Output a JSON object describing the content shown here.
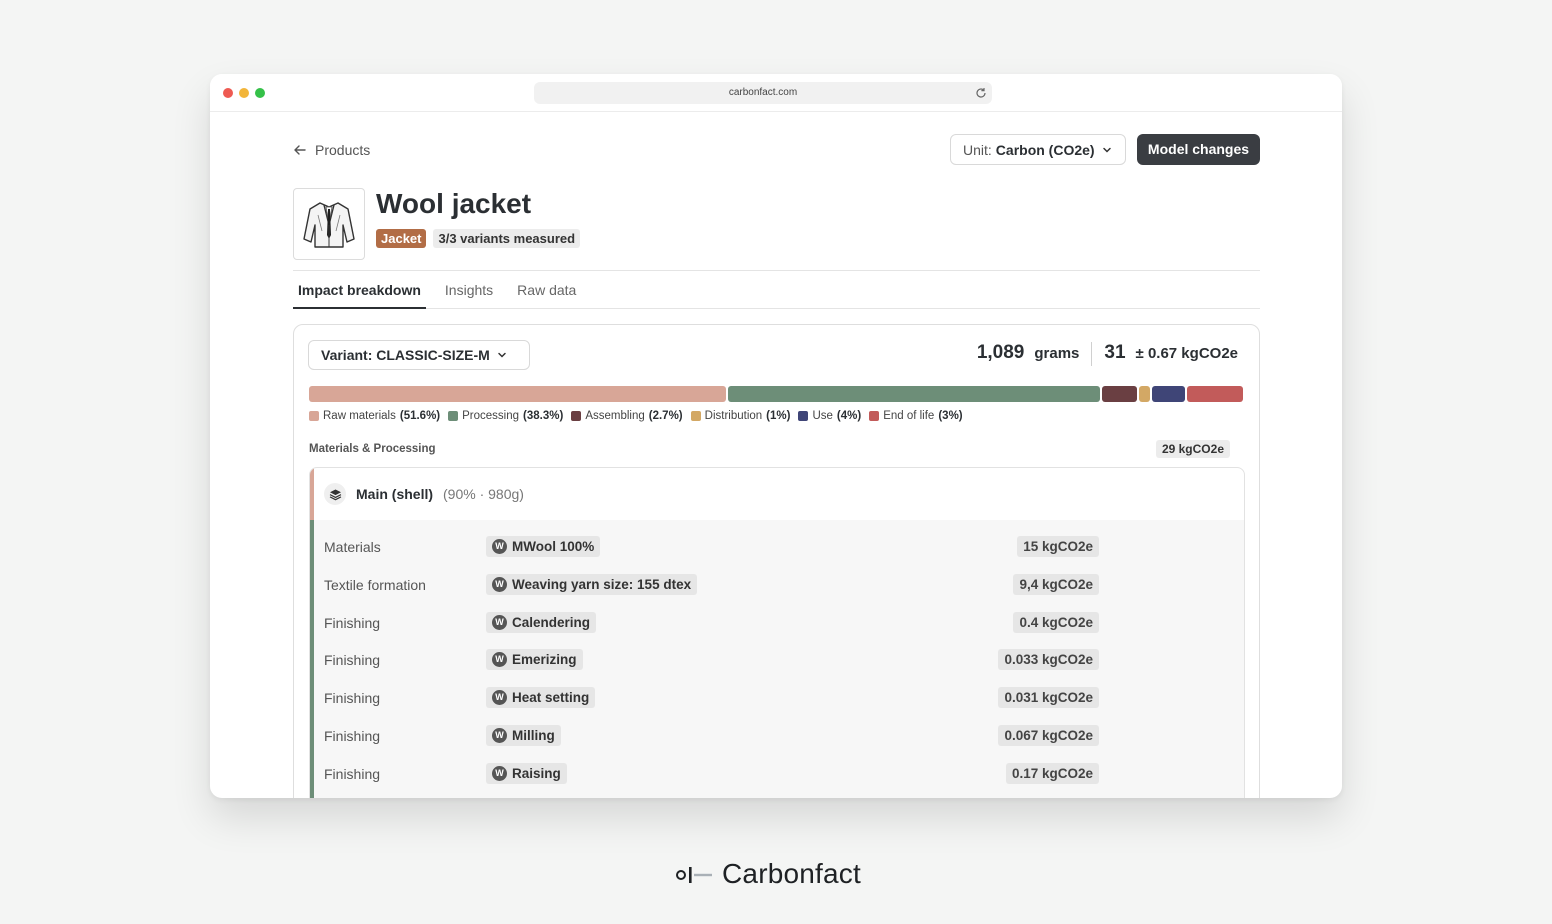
{
  "browser": {
    "url": "carbonfact.com"
  },
  "header": {
    "back_label": "Products",
    "unit_prefix": "Unit:",
    "unit_value": "Carbon (CO2e)",
    "model_changes_label": "Model changes"
  },
  "product": {
    "title": "Wool jacket",
    "category_badge": "Jacket",
    "variants_badge": "3/3 variants measured"
  },
  "tabs": [
    {
      "label": "Impact breakdown",
      "active": true
    },
    {
      "label": "Insights",
      "active": false
    },
    {
      "label": "Raw data",
      "active": false
    }
  ],
  "breakdown": {
    "variant_label": "Variant: CLASSIC-SIZE-M",
    "weight_value": "1,089",
    "weight_unit": "grams",
    "co2_value": "31",
    "co2_rest": "± 0.67 kgCO2e",
    "segments": [
      {
        "name": "Raw materials",
        "pct_label": "(51.6%)",
        "share": 45.0,
        "color": "#d8a697"
      },
      {
        "name": "Processing",
        "pct_label": "(38.3%)",
        "share": 40.0,
        "color": "#6d8e78"
      },
      {
        "name": "Assembling",
        "pct_label": "(2.7%)",
        "share": 3.8,
        "color": "#6a3f42"
      },
      {
        "name": "Distribution",
        "pct_label": "(1%)",
        "share": 1.2,
        "color": "#d3a865"
      },
      {
        "name": "Use",
        "pct_label": "(4%)",
        "share": 3.6,
        "color": "#3f4577"
      },
      {
        "name": "End of life",
        "pct_label": "(3%)",
        "share": 6.0,
        "color": "#c25b5a"
      }
    ]
  },
  "section": {
    "title": "Materials & Processing",
    "total": "29 kgCO2e"
  },
  "material": {
    "title": "Main (shell)",
    "meta": "(90% · 980g)",
    "rows": [
      {
        "label": "Materials",
        "chip": "MWool 100%",
        "value": "15 kgCO2e"
      },
      {
        "label": "Textile formation",
        "chip": "Weaving yarn size: 155 dtex",
        "value": "9,4 kgCO2e"
      },
      {
        "label": "Finishing",
        "chip": "Calendering",
        "value": "0.4 kgCO2e"
      },
      {
        "label": "Finishing",
        "chip": "Emerizing",
        "value": "0.033 kgCO2e"
      },
      {
        "label": "Finishing",
        "chip": "Heat setting",
        "value": "0.031 kgCO2e"
      },
      {
        "label": "Finishing",
        "chip": "Milling",
        "value": "0.067 kgCO2e"
      },
      {
        "label": "Finishing",
        "chip": "Raising",
        "value": "0.17 kgCO2e"
      }
    ]
  },
  "icons": {
    "chip_letter": "W"
  },
  "brand": {
    "name": "Carbonfact"
  }
}
